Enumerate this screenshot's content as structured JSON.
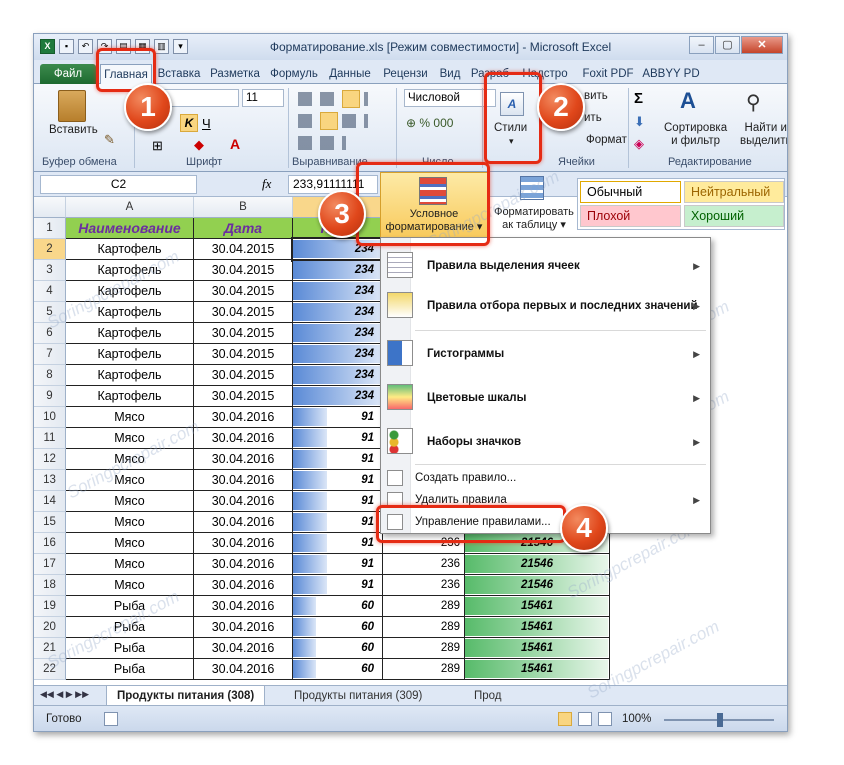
{
  "app": {
    "title": "Форматирование.xls  [Режим совместимости]  -  Microsoft Excel"
  },
  "tabs": [
    "Файл",
    "Главная",
    "Вставка",
    "Разметка",
    "Формуль",
    "Данные",
    "Рецензи",
    "Вид",
    "Разраб",
    "Надстро",
    "Foxit PDF",
    "ABBYY PD"
  ],
  "ribbon": {
    "paste_label": "Вставить",
    "font_name": "bri",
    "font_size": "11",
    "number_format": "Числовой",
    "styles_label": "Стили",
    "insert_label": "вить",
    "delete_label": "ить",
    "format_label": "Формат",
    "sort_label": "Сортировка",
    "sort_label2": "и фильтр",
    "find_label": "Найти и",
    "find_label2": "выделить",
    "groups": [
      "Буфер обмена",
      "Шрифт",
      "Выравнивание",
      "Число",
      "Ячейки",
      "Редактирование"
    ]
  },
  "formula_bar": {
    "name_box": "C2",
    "fx": "fx",
    "formula": "233,91111111"
  },
  "styles_gallery": {
    "cond_format_label1": "Условное",
    "cond_format_label2": "форматирование",
    "format_table_label1": "Форматировать",
    "format_table_label2": "ак таблицу",
    "normal": "Обычный",
    "neutral": "Нейтральный",
    "bad": "Плохой",
    "good": "Хороший"
  },
  "sheet": {
    "columns": [
      "A",
      "B",
      "C"
    ],
    "header": {
      "name": "Наименование",
      "date": "Дата",
      "qty": "Коли"
    },
    "rows": [
      {
        "n": "1"
      },
      {
        "n": "2",
        "a": "Картофель",
        "b": "30.04.2015",
        "c": "234"
      },
      {
        "n": "3",
        "a": "Картофель",
        "b": "30.04.2015",
        "c": "234"
      },
      {
        "n": "4",
        "a": "Картофель",
        "b": "30.04.2015",
        "c": "234"
      },
      {
        "n": "5",
        "a": "Картофель",
        "b": "30.04.2015",
        "c": "234"
      },
      {
        "n": "6",
        "a": "Картофель",
        "b": "30.04.2015",
        "c": "234"
      },
      {
        "n": "7",
        "a": "Картофель",
        "b": "30.04.2015",
        "c": "234"
      },
      {
        "n": "8",
        "a": "Картофель",
        "b": "30.04.2015",
        "c": "234"
      },
      {
        "n": "9",
        "a": "Картофель",
        "b": "30.04.2015",
        "c": "234"
      },
      {
        "n": "10",
        "a": "Мясо",
        "b": "30.04.2016",
        "c": "91"
      },
      {
        "n": "11",
        "a": "Мясо",
        "b": "30.04.2016",
        "c": "91"
      },
      {
        "n": "12",
        "a": "Мясо",
        "b": "30.04.2016",
        "c": "91"
      },
      {
        "n": "13",
        "a": "Мясо",
        "b": "30.04.2016",
        "c": "91"
      },
      {
        "n": "14",
        "a": "Мясо",
        "b": "30.04.2016",
        "c": "91"
      },
      {
        "n": "15",
        "a": "Мясо",
        "b": "30.04.2016",
        "c": "91"
      },
      {
        "n": "16",
        "a": "Мясо",
        "b": "30.04.2016",
        "c": "91",
        "d": "236",
        "e": "21546"
      },
      {
        "n": "17",
        "a": "Мясо",
        "b": "30.04.2016",
        "c": "91",
        "d": "236",
        "e": "21546"
      },
      {
        "n": "18",
        "a": "Мясо",
        "b": "30.04.2016",
        "c": "91",
        "d": "236",
        "e": "21546"
      },
      {
        "n": "19",
        "a": "Рыба",
        "b": "30.04.2016",
        "c": "60",
        "d": "289",
        "e": "15461"
      },
      {
        "n": "20",
        "a": "Рыба",
        "b": "30.04.2016",
        "c": "60",
        "d": "289",
        "e": "15461"
      },
      {
        "n": "21",
        "a": "Рыба",
        "b": "30.04.2016",
        "c": "60",
        "d": "289",
        "e": "15461"
      },
      {
        "n": "22",
        "a": "Рыба",
        "b": "30.04.2016",
        "c": "60",
        "d": "289",
        "e": "15461"
      }
    ]
  },
  "menu": {
    "items": [
      "Правила выделения ячеек",
      "Правила отбора первых и последних значений",
      "Гистограммы",
      "Цветовые шкалы",
      "Наборы значков",
      "Создать правило...",
      "Удалить правила",
      "Управление правилами..."
    ]
  },
  "sheet_tabs": [
    "Продукты питания (308)",
    "Продукты питания (309)",
    "Прод"
  ],
  "status": {
    "ready": "Готово",
    "zoom": "100%"
  },
  "badges": [
    "1",
    "2",
    "3",
    "4"
  ],
  "watermark": "Soringpcrepair.com",
  "colors": {
    "header_fill": "#92d050",
    "header_text": "#6b2ea0",
    "highlight": "#e52b14",
    "badge": "#e0471b"
  }
}
